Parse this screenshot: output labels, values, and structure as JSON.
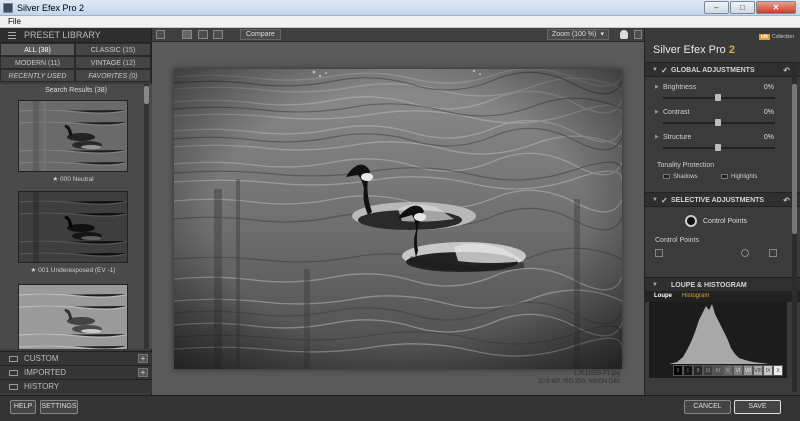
{
  "window": {
    "title": "Silver Efex Pro 2",
    "controls": [
      "–",
      "□",
      "✕"
    ]
  },
  "menu": {
    "file": "File"
  },
  "library": {
    "header": "PRESET LIBRARY",
    "filters": [
      "ALL (38)",
      "CLASSIC (15)",
      "MODERN (11)",
      "VINTAGE (12)",
      "RECENTLY USED",
      "FAVORITES (0)"
    ],
    "results_title": "Search Results (38)",
    "presets": [
      "★ 000 Neutral",
      "★ 001 Underexposed (EV -1)"
    ],
    "sections": [
      "CUSTOM",
      "IMPORTED",
      "HISTORY"
    ],
    "plus": "+"
  },
  "toolbar": {
    "compare": "Compare",
    "zoom": "Zoom (100 %)"
  },
  "photo": {
    "filename": "LJK11559-P1.jpg",
    "meta": "10.0 MP, ISO 250, NIKON D80"
  },
  "right": {
    "brand_main": "Silver Efex Pro ",
    "brand_num": "2",
    "logo_badge": "nik",
    "logo_text": "Collection",
    "global_header": "GLOBAL ADJUSTMENTS",
    "sliders": [
      {
        "label": "Brightness",
        "value": "0%"
      },
      {
        "label": "Contrast",
        "value": "0%"
      },
      {
        "label": "Structure",
        "value": "0%"
      }
    ],
    "tonality": "Tonality Protection",
    "shadows": "Shadows",
    "highlights": "Highlights",
    "selective_header": "SELECTIVE ADJUSTMENTS",
    "control_points_btn": "Control Points",
    "control_points_label": "Control Points",
    "loupe_header": "LOUPE & HISTOGRAM",
    "tab_loupe": "Loupe",
    "tab_histogram": "Histogram",
    "zones": [
      "0",
      "I",
      "II",
      "III",
      "IV",
      "V",
      "VI",
      "VII",
      "VIII",
      "IX",
      "X"
    ],
    "check": "✓",
    "reset": "↶",
    "caret": "▼",
    "slider_caret": "▶"
  },
  "buttons": {
    "help": "HELP",
    "settings": "SETTINGS",
    "cancel": "CANCEL",
    "save": "SAVE"
  }
}
